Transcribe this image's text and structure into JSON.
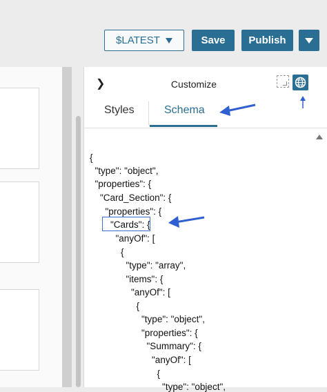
{
  "toolbar": {
    "version_label": "$LATEST",
    "save_label": "Save",
    "publish_label": "Publish"
  },
  "panel": {
    "title": "Customize",
    "tabs": [
      {
        "label": "Styles",
        "active": false
      },
      {
        "label": "Schema",
        "active": true
      }
    ]
  },
  "schema_lines": [
    "{",
    "  \"type\": \"object\",",
    "  \"properties\": {",
    "    \"Card_Section\": {",
    "      \"properties\": {",
    "        \"Cards\": {",
    "          \"anyOf\": [",
    "            {",
    "              \"type\": \"array\",",
    "              \"items\": {",
    "                \"anyOf\": [",
    "                  {",
    "                    \"type\": \"object\",",
    "                    \"properties\": {",
    "                      \"Summary\": {",
    "                        \"anyOf\": [",
    "                          {",
    "                            \"type\": \"object\","
  ],
  "colors": {
    "accent": "#2a6f93",
    "annotation_arrow": "#2f5fd0",
    "background": "#ececed"
  }
}
